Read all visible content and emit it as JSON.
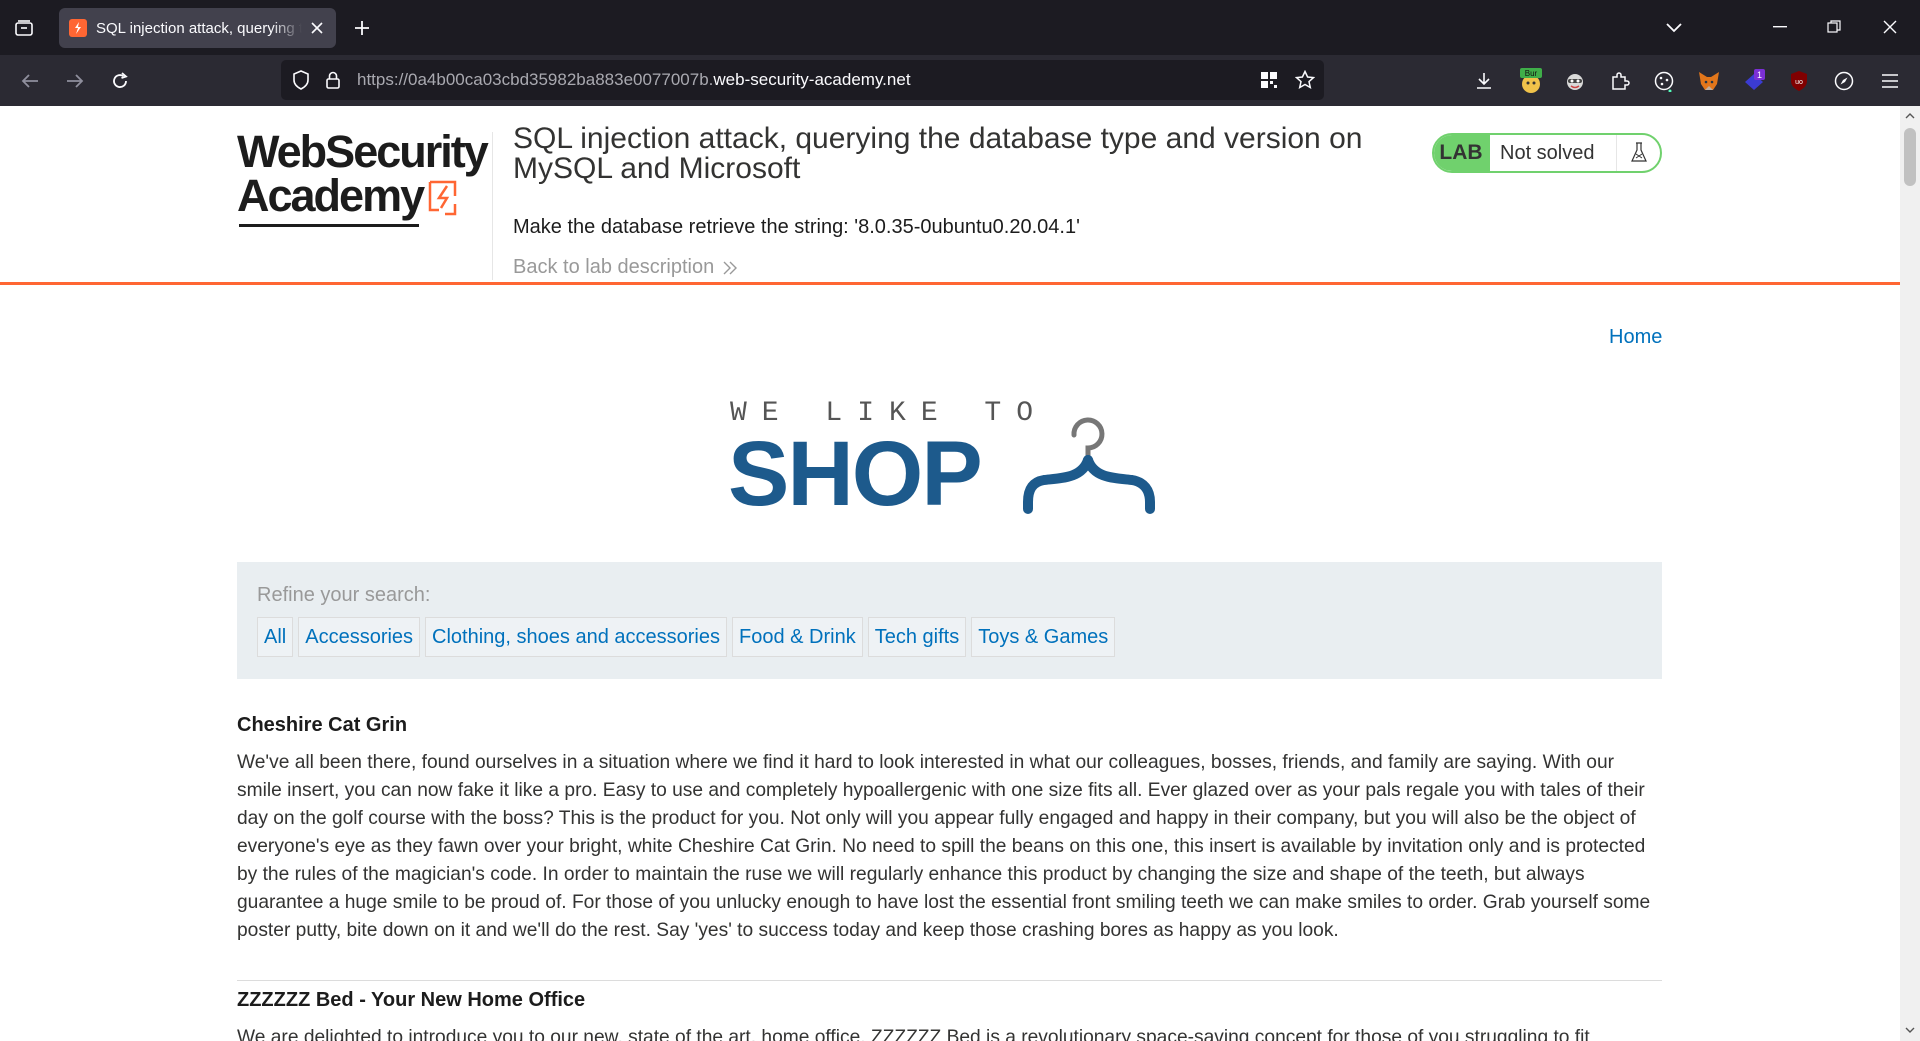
{
  "browser": {
    "tab": {
      "title": "SQL injection attack, querying the database type and version on MySQL and Microsoft"
    },
    "url": {
      "prefix": "https://0a4b00ca03cbd35982ba883e0077007b.",
      "domain": "web-security-academy.net"
    },
    "extensions": [
      "burp-extension-icon",
      "privacy-badger-icon",
      "puzzle-extensions-icon",
      "cookie-icon",
      "metamask-fox-icon",
      "badge-extension-icon",
      "ublock-icon",
      "compass-icon"
    ],
    "extension_badges": {
      "burp": "Bur",
      "purple": "1",
      "ublock": "uo"
    }
  },
  "academy": {
    "logo": {
      "line1": "WebSecurity",
      "line2": "Academy"
    },
    "lab_title": "SQL injection attack, querying the database type and version on MySQL and Microsoft",
    "description": "Make the database retrieve the string: '8.0.35-0ubuntu0.20.04.1'",
    "back_link": "Back to lab description",
    "status": {
      "badge": "LAB",
      "text": "Not solved"
    }
  },
  "nav": {
    "home": "Home"
  },
  "shop_logo": {
    "tagline": "WE LIKE TO",
    "word": "SHOP"
  },
  "filter": {
    "label": "Refine your search:",
    "categories": [
      "All",
      "Accessories",
      "Clothing, shoes and accessories",
      "Food & Drink",
      "Tech gifts",
      "Toys & Games"
    ]
  },
  "products": [
    {
      "name": "Cheshire Cat Grin",
      "description": "We've all been there, found ourselves in a situation where we find it hard to look interested in what our colleagues, bosses, friends, and family are saying. With our smile insert, you can now fake it like a pro. Easy to use and completely hypoallergenic with one size fits all. Ever glazed over as your pals regale you with tales of their day on the golf course with the boss? This is the product for you. Not only will you appear fully engaged and happy in their company, but you will also be the object of everyone's eye as they fawn over your bright, white Cheshire Cat Grin. No need to spill the beans on this one, this insert is available by invitation only and is protected by the rules of the magician's code. In order to maintain the ruse we will regularly enhance this product by changing the size and shape of the teeth, but always guarantee a huge smile to be proud of. For those of you unlucky enough to have lost the essential front smiling teeth we can make smiles to order. Grab yourself some poster putty, bite down on it and we'll do the rest. Say 'yes' to success today and keep those crashing bores as happy as you look."
    },
    {
      "name": "ZZZZZZ Bed - Your New Home Office",
      "description": "We are delighted to introduce you to our new, state of the art, home office. ZZZZZZ Bed is a revolutionary space-saving concept for those of you struggling to fit"
    }
  ]
}
